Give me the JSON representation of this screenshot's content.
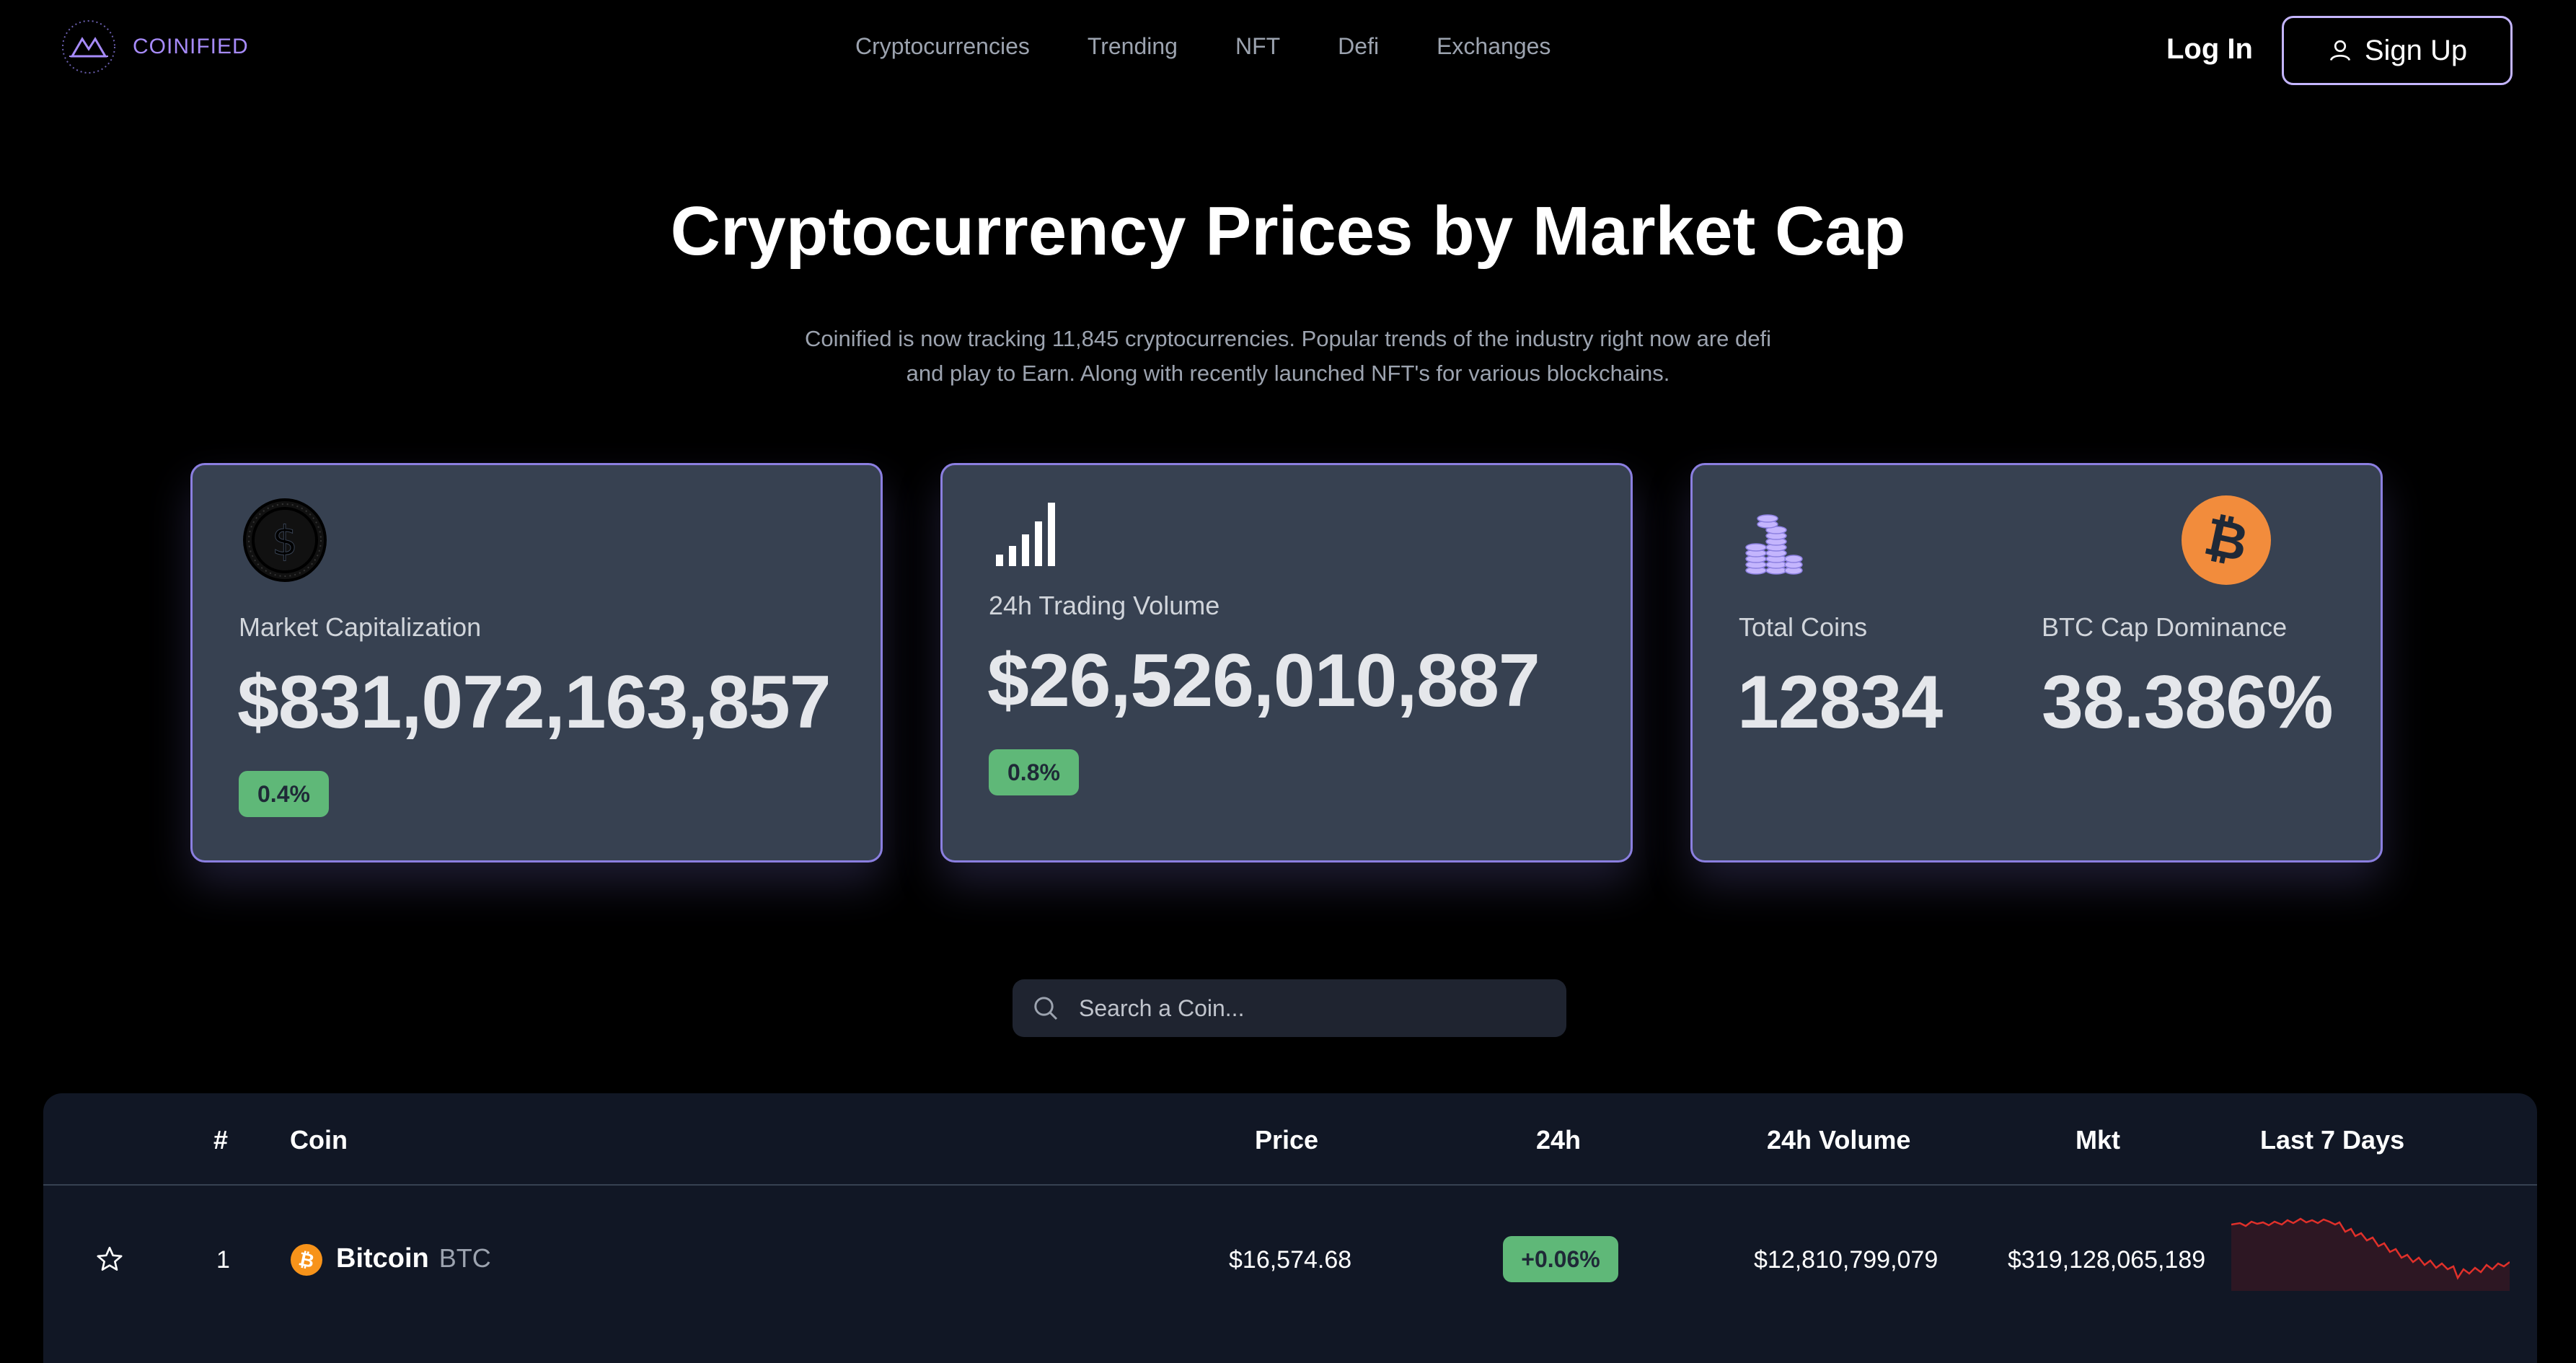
{
  "brand": {
    "name": "COINIFIED"
  },
  "nav": {
    "links": [
      "Cryptocurrencies",
      "Trending",
      "NFT",
      "Defi",
      "Exchanges"
    ],
    "login": "Log In",
    "signup": "Sign Up"
  },
  "hero": {
    "title": "Cryptocurrency Prices by Market Cap",
    "subtitle": "Coinified is now tracking 11,845 cryptocurrencies. Popular trends of the industry right now are defi and play to Earn. Along with recently launched NFT's for various blockchains."
  },
  "cards": {
    "market_cap": {
      "label": "Market Capitalization",
      "value": "$831,072,163,857",
      "change": "0.4%"
    },
    "volume": {
      "label": "24h Trading Volume",
      "value": "$26,526,010,887",
      "change": "0.8%"
    },
    "total_coins": {
      "label": "Total Coins",
      "value": "12834"
    },
    "btc_dominance": {
      "label": "BTC Cap Dominance",
      "value": "38.386%"
    }
  },
  "search": {
    "placeholder": "Search a Coin..."
  },
  "table": {
    "headers": {
      "rank": "#",
      "coin": "Coin",
      "price": "Price",
      "change": "24h",
      "volume": "24h Volume",
      "mkt": "Mkt",
      "last7": "Last 7 Days"
    },
    "rows": [
      {
        "rank": "1",
        "name": "Bitcoin",
        "symbol": "BTC",
        "price": "$16,574.68",
        "change": "+0.06%",
        "volume": "$12,810,799,079",
        "mkt": "$319,128,065,189"
      }
    ]
  },
  "colors": {
    "accent": "#a78bfa",
    "positive": "#5fb878",
    "sparkline": "#e0302a",
    "bitcoin": "#f7931a"
  },
  "icons": [
    "logo-mark",
    "user-icon",
    "dollar-coin-icon",
    "signal-bars-icon",
    "coin-stack-icon",
    "bitcoin-icon",
    "search-icon",
    "star-icon"
  ]
}
